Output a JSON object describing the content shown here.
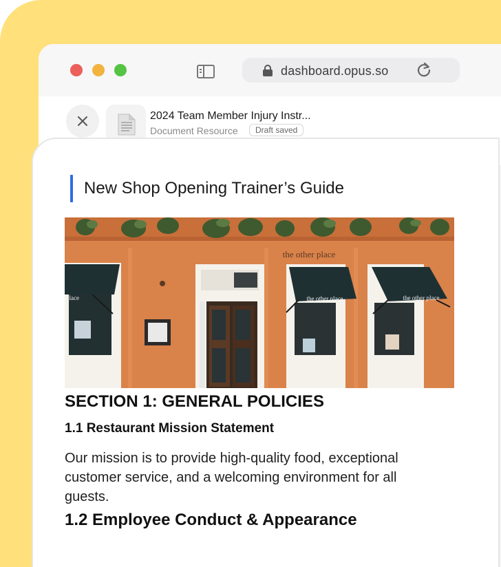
{
  "browser": {
    "url": "dashboard.opus.so"
  },
  "document": {
    "title": "2024 Team Member Injury Instr...",
    "type_label": "Document Resource",
    "status_badge": "Draft saved"
  },
  "page": {
    "heading": "New Shop Opening Trainer’s Guide",
    "image_signs": {
      "facade_sign": "the other place",
      "awning_left": "place",
      "awning_mid": "the other place",
      "awning_right": "the other place"
    },
    "section_title": "SECTION 1: GENERAL POLICIES",
    "subsection_1": "1.1 Restaurant Mission Statement",
    "paragraph_1": "Our mission is to provide high-quality food, exceptional customer service, and a welcoming environment for all guests.",
    "subsection_2": "1.2 Employee Conduct & Appearance"
  },
  "icons": {
    "close": "close-icon",
    "sidebar": "sidebar-toggle-icon",
    "lock": "lock-icon",
    "reload": "reload-icon",
    "file": "document-file-icon"
  },
  "colors": {
    "background_accent": "#FFE07A",
    "heading_bar": "#2F6BE4",
    "traffic_red": "#EC5F5A",
    "traffic_yellow": "#F2B33F",
    "traffic_green": "#56C443"
  }
}
